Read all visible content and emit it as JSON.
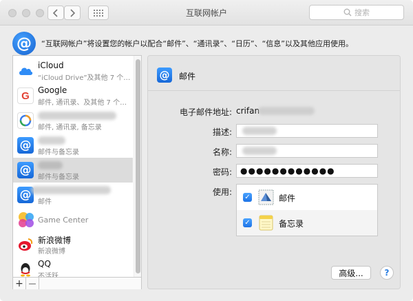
{
  "window": {
    "title": "互联网帐户"
  },
  "search": {
    "placeholder": "搜索"
  },
  "info": {
    "text": "“互联网帐户”将设置您的帐户以配合“邮件”、“通讯录”、“日历”、“信息”以及其他应用使用。"
  },
  "accounts": [
    {
      "name": "iCloud",
      "detail": "“iCloud Drive”及其他 7 个…",
      "icon": "icloud-icon"
    },
    {
      "name": "Google",
      "detail": "邮件, 通讯录、及其他 7 个…",
      "icon": "google-icon"
    },
    {
      "name": "",
      "detail": "邮件, 通讯录, 备忘录",
      "icon": "exchange-icon"
    },
    {
      "name": "",
      "detail": "邮件与备忘录",
      "icon": "at-mail-icon"
    },
    {
      "name": "",
      "detail": "邮件与备忘录",
      "icon": "at-mail-icon"
    },
    {
      "name": "",
      "detail": "邮件",
      "icon": "at-mail-icon"
    },
    {
      "name": "Game Center",
      "detail": "",
      "icon": "game-center-icon"
    },
    {
      "name": "新浪微博",
      "detail": "新浪微博",
      "icon": "weibo-icon"
    },
    {
      "name": "QQ",
      "detail": "不活跃",
      "icon": "qq-icon"
    }
  ],
  "buttons": {
    "add": "+",
    "remove": "—",
    "advanced": "高级...",
    "help": "?"
  },
  "detail": {
    "title": "邮件",
    "email_label": "电子邮件地址:",
    "email_value": "crifan",
    "description_label": "描述:",
    "name_label": "名称:",
    "password_label": "密码:",
    "password_value": "●●●●●●●●●●●●",
    "use_label": "使用:",
    "apps": [
      {
        "label": "邮件",
        "checked": true,
        "icon": "mail-stamp-icon"
      },
      {
        "label": "备忘录",
        "checked": true,
        "icon": "notes-icon"
      }
    ]
  },
  "colors": {
    "accent": "#1d73e6",
    "selected_row": "#dcdcdc",
    "panel": "#e5e5e5"
  }
}
